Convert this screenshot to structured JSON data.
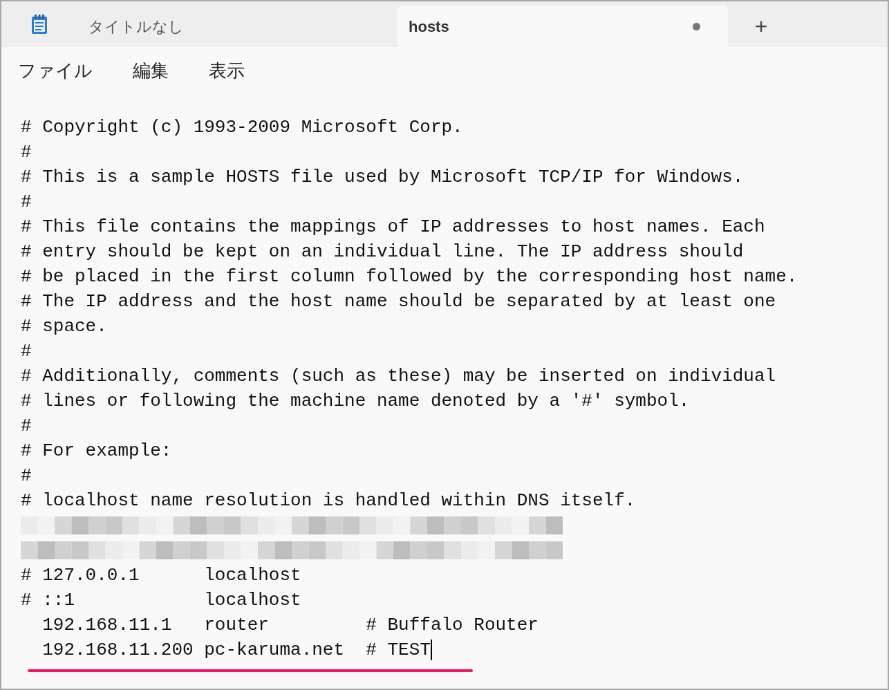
{
  "tabs": [
    {
      "title": "タイトルなし",
      "selected": false,
      "modified": false
    },
    {
      "title": "hosts",
      "selected": true,
      "modified": true
    }
  ],
  "new_tab": "+",
  "menu": [
    "ファイル",
    "編集",
    "表示"
  ],
  "editor": {
    "lines_before": [
      "# Copyright (c) 1993-2009 Microsoft Corp.",
      "#",
      "# This is a sample HOSTS file used by Microsoft TCP/IP for Windows.",
      "#",
      "# This file contains the mappings of IP addresses to host names. Each",
      "# entry should be kept on an individual line. The IP address should",
      "# be placed in the first column followed by the corresponding host name.",
      "# The IP address and the host name should be separated by at least one",
      "# space.",
      "#",
      "# Additionally, comments (such as these) may be inserted on individual",
      "# lines or following the machine name denoted by a '#' symbol.",
      "#",
      "# For example:",
      "#",
      "# localhost name resolution is handled within DNS itself."
    ],
    "lines_after": [
      "# 127.0.0.1      localhost",
      "# ::1            localhost",
      "  192.168.11.1   router         # Buffalo Router",
      "  192.168.11.200 pc-karuma.net  # TEST"
    ]
  }
}
